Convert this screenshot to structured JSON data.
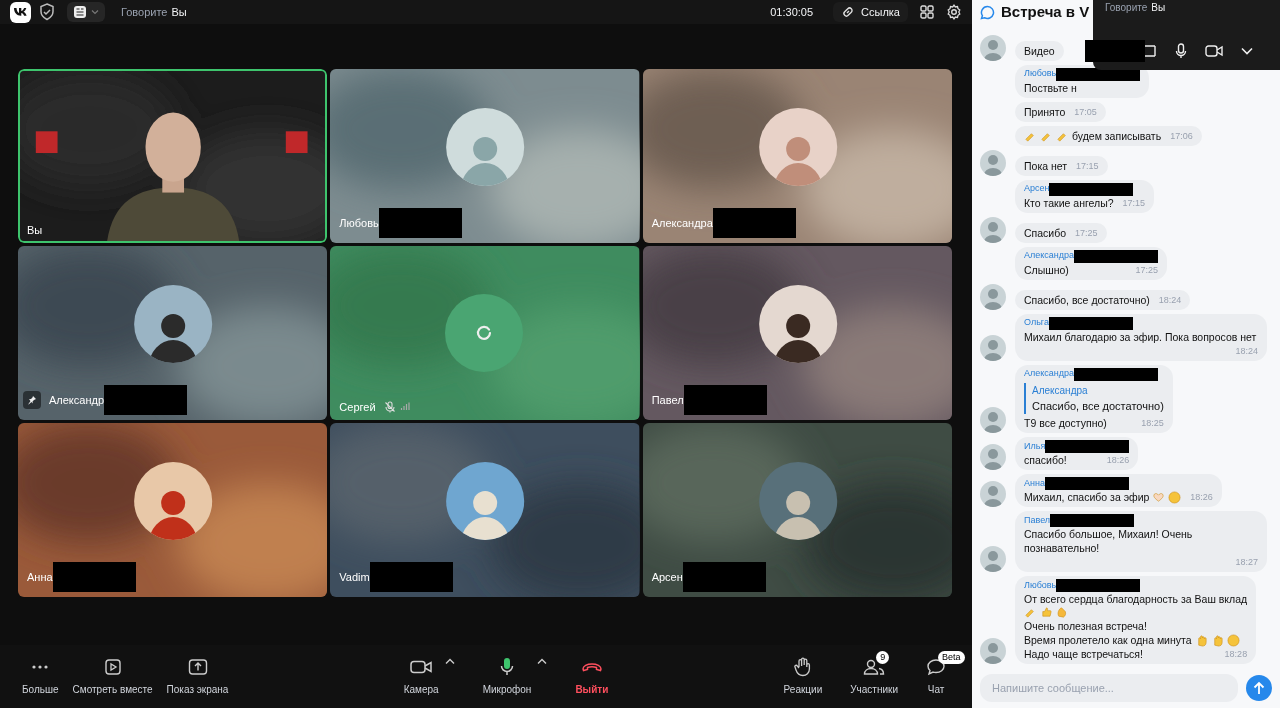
{
  "top_bar": {
    "speaking_label": "Говорите",
    "speaking_name": "Вы",
    "timer": "01:30:05",
    "link_button": "Ссылка"
  },
  "tiles": [
    {
      "name": "Вы",
      "kind": "camera",
      "speaking": true,
      "redacted": false,
      "pinned": false,
      "muted": false
    },
    {
      "name": "Любовь",
      "kind": "avatar",
      "speaking": false,
      "redacted": true,
      "pinned": false,
      "muted": false
    },
    {
      "name": "Александра",
      "kind": "avatar",
      "speaking": false,
      "redacted": true,
      "pinned": false,
      "muted": false
    },
    {
      "name": "Александр",
      "kind": "avatar",
      "speaking": false,
      "redacted": true,
      "pinned": true,
      "muted": false
    },
    {
      "name": "Сергей",
      "kind": "loading",
      "speaking": false,
      "redacted": false,
      "pinned": false,
      "muted": true
    },
    {
      "name": "Павел",
      "kind": "avatar",
      "speaking": false,
      "redacted": true,
      "pinned": false,
      "muted": false
    },
    {
      "name": "Анна",
      "kind": "avatar",
      "speaking": false,
      "redacted": true,
      "pinned": false,
      "muted": false
    },
    {
      "name": "Vadim",
      "kind": "avatar",
      "speaking": false,
      "redacted": true,
      "pinned": false,
      "muted": false
    },
    {
      "name": "Арсен",
      "kind": "avatar",
      "speaking": false,
      "redacted": true,
      "pinned": false,
      "muted": false
    }
  ],
  "toolbar": {
    "left": [
      {
        "kind": "more",
        "label": "Больше"
      },
      {
        "kind": "watch",
        "label": "Смотреть вместе"
      },
      {
        "kind": "share",
        "label": "Показ экрана"
      }
    ],
    "center": [
      {
        "kind": "camera",
        "label": "Камера"
      },
      {
        "kind": "mic",
        "label": "Микрофон"
      },
      {
        "kind": "leave",
        "label": "Выйти"
      }
    ],
    "right": [
      {
        "kind": "reactions",
        "label": "Реакции"
      },
      {
        "kind": "participants",
        "label": "Участники",
        "badge": "9"
      },
      {
        "kind": "chat",
        "label": "Чат",
        "badge": "Beta"
      }
    ]
  },
  "chat": {
    "title": "Встреча в V",
    "messages": [
      {
        "redacted": false,
        "avatar": true,
        "lines": [
          [
            {
              "kind": "text",
              "text": "Видео"
            }
          ]
        ]
      },
      {
        "author": "Любовь",
        "redacted": true,
        "avatar": false,
        "lines": [
          [
            {
              "kind": "text",
              "text": "Поствьте н"
            }
          ]
        ]
      },
      {
        "redacted": false,
        "avatar": false,
        "lines": [
          [
            {
              "kind": "text",
              "text": "Принято"
            }
          ]
        ],
        "time": "17:05"
      },
      {
        "redacted": false,
        "avatar": false,
        "lines": [
          [
            {
              "kind": "writing-hand"
            },
            {
              "kind": "writing-hand"
            },
            {
              "kind": "writing-hand"
            },
            {
              "kind": "text",
              "text": "будем записывать"
            }
          ]
        ],
        "time": "17:06"
      },
      {
        "redacted": false,
        "avatar": true,
        "lines": [
          [
            {
              "kind": "text",
              "text": "Пока нет"
            }
          ]
        ],
        "time": "17:15"
      },
      {
        "author": "Арсен",
        "redacted": true,
        "avatar": false,
        "lines": [
          [
            {
              "kind": "text",
              "text": "Кто такие ангелы?"
            }
          ]
        ],
        "time": "17:15"
      },
      {
        "redacted": false,
        "avatar": true,
        "lines": [
          [
            {
              "kind": "text",
              "text": "Спасибо"
            }
          ]
        ],
        "time": "17:25"
      },
      {
        "author": "Александра",
        "redacted": true,
        "avatar": false,
        "lines": [
          [
            {
              "kind": "text",
              "text": "Слышно)"
            }
          ]
        ],
        "time": "17:25"
      },
      {
        "redacted": false,
        "avatar": true,
        "lines": [
          [
            {
              "kind": "text",
              "text": "Спасибо, все достаточно)"
            }
          ]
        ],
        "time": "18:24"
      },
      {
        "author": "Ольга",
        "redacted": true,
        "avatar": true,
        "lines": [
          [
            {
              "kind": "text",
              "text": "Михаил благодарю за эфир. Пока вопросов нет"
            }
          ]
        ],
        "time": "18:24"
      },
      {
        "author": "Александра",
        "redacted": true,
        "avatar": true,
        "quote": {
          "author": "Александра",
          "text": "Спасибо, все достаточно)"
        },
        "lines": [
          [
            {
              "kind": "text",
              "text": "Т9 все доступно)"
            }
          ]
        ],
        "time": "18:25"
      },
      {
        "author": "Илья",
        "redacted": true,
        "avatar": true,
        "lines": [
          [
            {
              "kind": "text",
              "text": "спасибо!"
            }
          ]
        ],
        "time": "18:26"
      },
      {
        "author": "Анна",
        "redacted": true,
        "avatar": true,
        "lines": [
          [
            {
              "kind": "text",
              "text": "Михаил, спасибо за эфир"
            },
            {
              "kind": "heart-hands"
            },
            {
              "kind": "smile"
            }
          ]
        ],
        "time": "18:26"
      },
      {
        "author": "Павел",
        "redacted": true,
        "avatar": true,
        "lines": [
          [
            {
              "kind": "text",
              "text": "Спасибо большое, Михаил! Очень познавательно!"
            }
          ]
        ],
        "time": "18:27"
      },
      {
        "author": "Любовь",
        "redacted": true,
        "avatar": true,
        "lines": [
          [
            {
              "kind": "text",
              "text": "От всего сердца благодарность за Ваш вклад"
            }
          ],
          [
            {
              "kind": "writing-hand"
            },
            {
              "kind": "thumbs-up"
            },
            {
              "kind": "clap"
            }
          ],
          [
            {
              "kind": "text",
              "text": "Очень полезная встреча!"
            }
          ],
          [
            {
              "kind": "text",
              "text": "Время пролетело как одна минута"
            },
            {
              "kind": "wave"
            },
            {
              "kind": "wave"
            },
            {
              "kind": "smile"
            }
          ],
          [
            {
              "kind": "text",
              "text": "Надо чаще встречаться!"
            }
          ]
        ],
        "time": "18:28"
      }
    ],
    "input": {
      "placeholder": "Напишите сообщение..."
    }
  },
  "overlay": {
    "speaking_label": "Говорите",
    "speaking_name": "Вы"
  }
}
